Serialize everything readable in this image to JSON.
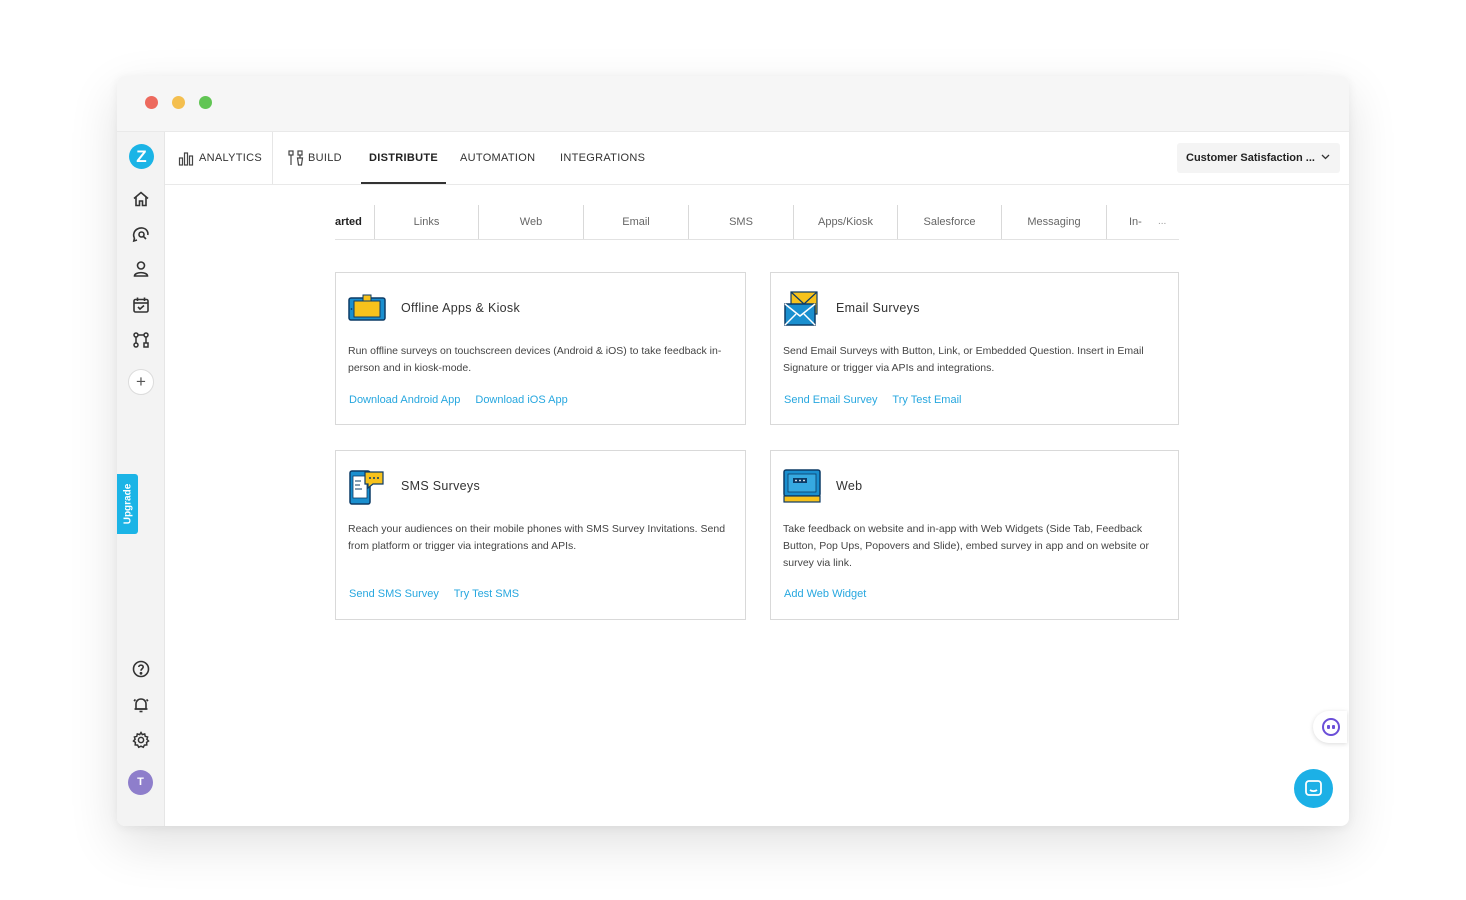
{
  "window": {
    "title": ""
  },
  "sidebar": {
    "logo": "Z",
    "items": [
      {
        "icon": "home-icon"
      },
      {
        "icon": "chat-search-icon"
      },
      {
        "icon": "user-icon"
      },
      {
        "icon": "calendar-check-icon"
      },
      {
        "icon": "workflow-icon"
      }
    ],
    "add_label": "+",
    "upgrade_label": "Upgrade",
    "bottom_items": [
      {
        "icon": "help-icon"
      },
      {
        "icon": "bell-icon"
      },
      {
        "icon": "settings-icon"
      }
    ],
    "avatar_initial": "T"
  },
  "topnav": {
    "items": [
      {
        "label": "ANALYTICS",
        "icon": "analytics-icon"
      },
      {
        "label": "BUILD",
        "icon": "build-icon"
      },
      {
        "label": "DISTRIBUTE",
        "active": true
      },
      {
        "label": "AUTOMATION"
      },
      {
        "label": "INTEGRATIONS"
      }
    ],
    "survey_select": "Customer Satisfaction ..."
  },
  "tabs": {
    "items": [
      "arted",
      "Links",
      "Web",
      "Email",
      "SMS",
      "Apps/Kiosk",
      "Salesforce",
      "Messaging",
      "In-"
    ],
    "more": "..."
  },
  "cards": [
    {
      "title": "Offline Apps & Kiosk",
      "icon": "tablet-kiosk-icon",
      "description": "Run offline surveys on touchscreen devices (Android & iOS) to take feedback in-person and in kiosk-mode.",
      "links": [
        "Download Android App",
        "Download iOS App"
      ]
    },
    {
      "title": "Email Surveys",
      "icon": "email-envelope-icon",
      "description": "Send Email Surveys with Button, Link, or Embedded Question. Insert in Email Signature or trigger via APIs and integrations.",
      "links": [
        "Send Email Survey",
        "Try Test Email"
      ]
    },
    {
      "title": "SMS Surveys",
      "icon": "sms-phone-icon",
      "description": "Reach your audiences on their mobile phones with SMS Survey Invitations. Send from platform or trigger via integrations and APIs.",
      "links": [
        "Send SMS Survey",
        "Try Test SMS"
      ]
    },
    {
      "title": "Web",
      "icon": "web-monitor-icon",
      "description": "Take feedback on website and in-app with Web Widgets (Side Tab, Feedback Button, Pop Ups, Popovers and Slide), embed survey in app and on website or survey via link.",
      "links": [
        "Add Web Widget"
      ]
    }
  ],
  "colors": {
    "accent": "#1bb4e6",
    "link": "#27a7df",
    "avatar": "#8e7ecb",
    "chat_bot": "#6b4fd8"
  }
}
